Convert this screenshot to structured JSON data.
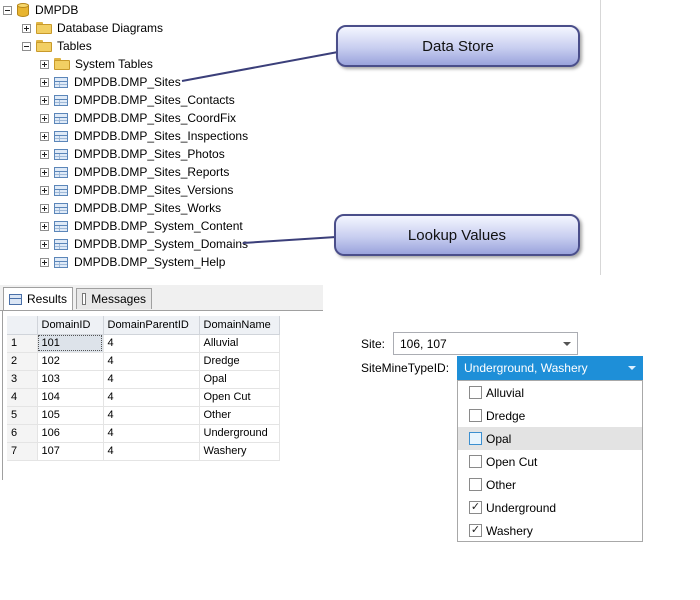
{
  "tree": {
    "database": "DMPDB",
    "database_diagrams": "Database Diagrams",
    "tables": "Tables",
    "system_tables": "System Tables",
    "table_items": [
      "DMPDB.DMP_Sites",
      "DMPDB.DMP_Sites_Contacts",
      "DMPDB.DMP_Sites_CoordFix",
      "DMPDB.DMP_Sites_Inspections",
      "DMPDB.DMP_Sites_Photos",
      "DMPDB.DMP_Sites_Reports",
      "DMPDB.DMP_Sites_Versions",
      "DMPDB.DMP_Sites_Works",
      "DMPDB.DMP_System_Content",
      "DMPDB.DMP_System_Domains",
      "DMPDB.DMP_System_Help"
    ]
  },
  "callouts": {
    "data_store": "Data Store",
    "lookup_values": "Lookup Values"
  },
  "results": {
    "tab_results": "Results",
    "tab_messages": "Messages",
    "columns": [
      "DomainID",
      "DomainParentID",
      "DomainName"
    ],
    "rows": [
      [
        "1",
        "101",
        "4",
        "Alluvial"
      ],
      [
        "2",
        "102",
        "4",
        "Dredge"
      ],
      [
        "3",
        "103",
        "4",
        "Opal"
      ],
      [
        "4",
        "104",
        "4",
        "Open Cut"
      ],
      [
        "5",
        "105",
        "4",
        "Other"
      ],
      [
        "6",
        "106",
        "4",
        "Underground"
      ],
      [
        "7",
        "107",
        "4",
        "Washery"
      ]
    ]
  },
  "form": {
    "site_label": "Site:",
    "site_value": "106, 107",
    "mine_type_label": "SiteMineTypeID:",
    "mine_type_value": "Underground, Washery",
    "options": [
      {
        "label": "Alluvial",
        "checked": false
      },
      {
        "label": "Dredge",
        "checked": false
      },
      {
        "label": "Opal",
        "checked": false
      },
      {
        "label": "Open Cut",
        "checked": false
      },
      {
        "label": "Other",
        "checked": false
      },
      {
        "label": "Underground",
        "checked": true
      },
      {
        "label": "Washery",
        "checked": true
      }
    ],
    "check_glyph": "✓",
    "accent_color": "#1e8fd8"
  }
}
